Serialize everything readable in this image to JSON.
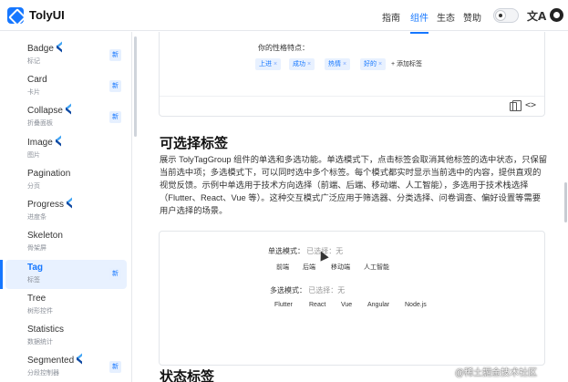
{
  "header": {
    "brand": "TolyUI",
    "nav": [
      "指南",
      "组件",
      "生态",
      "赞助"
    ],
    "active_nav": 1,
    "lang_icon_glyph": "文A"
  },
  "sidebar": {
    "items": [
      {
        "name": "Badge",
        "sub": "标记",
        "flutter": true,
        "new": true
      },
      {
        "name": "Card",
        "sub": "卡片",
        "flutter": false,
        "new": true
      },
      {
        "name": "Collapse",
        "sub": "折叠面板",
        "flutter": true,
        "new": true
      },
      {
        "name": "Image",
        "sub": "图片",
        "flutter": true,
        "new": false
      },
      {
        "name": "Pagination",
        "sub": "分页",
        "flutter": false,
        "new": false
      },
      {
        "name": "Progress",
        "sub": "进度条",
        "flutter": true,
        "new": false
      },
      {
        "name": "Skeleton",
        "sub": "骨架屏",
        "flutter": false,
        "new": false
      },
      {
        "name": "Tag",
        "sub": "标签",
        "flutter": false,
        "new": true,
        "active": true
      },
      {
        "name": "Tree",
        "sub": "树形控件",
        "flutter": false,
        "new": false
      },
      {
        "name": "Statistics",
        "sub": "数据统计",
        "flutter": false,
        "new": false
      },
      {
        "name": "Segmented",
        "sub": "分段控制器",
        "flutter": true,
        "new": true
      }
    ],
    "new_label": "新"
  },
  "demo1": {
    "label": "你的性格特点：",
    "chips": [
      "上进",
      "成功",
      "热情",
      "好的"
    ],
    "chip_close": "×",
    "add_tag": "+ 添加标签"
  },
  "section1": {
    "title": "可选择标签",
    "paragraph": "展示 TolyTagGroup 组件的单选和多选功能。单选模式下，点击标签会取消其他标签的选中状态，只保留当前选中项；多选模式下，可以同时选中多个标签。每个模式都实时显示当前选中的内容，提供直观的视觉反馈。示例中单选用于技术方向选择（前端、后端、移动端、人工智能），多选用于技术栈选择（Flutter、React、Vue 等）。这种交互模式广泛应用于筛选器、分类选择、问卷调查、偏好设置等需要用户选择的场景。"
  },
  "demo2": {
    "single_label": "单选模式：",
    "single_hint": "已选择：无",
    "single_options": [
      "前端",
      "后端",
      "移动端",
      "人工智能"
    ],
    "multi_label": "多选模式：",
    "multi_hint": "已选择：无",
    "multi_options": [
      "Flutter",
      "React",
      "Vue",
      "Angular",
      "Node.js"
    ]
  },
  "section2": {
    "title": "状态标签"
  },
  "footer_overlay": {
    "watermark": "@稀土掘金技术社区"
  },
  "colors": {
    "accent": "#1677ff",
    "active_bg": "#e8f1ff"
  }
}
